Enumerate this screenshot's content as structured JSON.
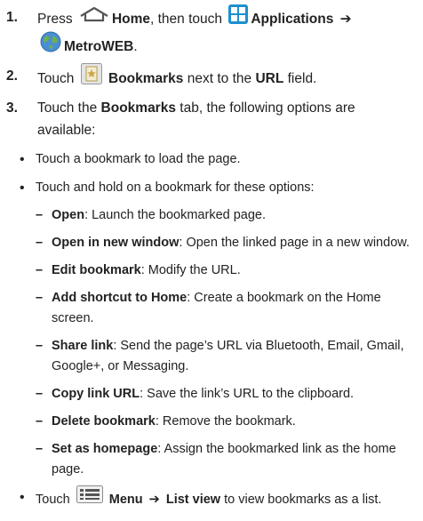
{
  "steps": [
    {
      "num": "1.",
      "press": "Press",
      "home": "Home",
      "then_touch": ", then touch",
      "applications": "Applications",
      "arrow": "➔",
      "metroweb": "MetroWEB",
      "end": "."
    },
    {
      "num": "2.",
      "touch": "Touch",
      "bookmarks": "Bookmarks",
      "next_to": "next to the",
      "url": "URL",
      "field": "field."
    },
    {
      "num": "3.",
      "touch_the": "Touch the",
      "bookmarks_tab": "Bookmarks",
      "rest": "tab, the following options are available:"
    }
  ],
  "bullets": {
    "b1": "Touch a bookmark to load the page.",
    "b2": "Touch and hold on a bookmark for these options:",
    "b3": {
      "touch": "Touch",
      "menu": "Menu",
      "arrow": "➔",
      "list_view": "List view",
      "rest": "to view bookmarks as a list."
    }
  },
  "options": [
    {
      "label": "Open",
      "desc": ": Launch the bookmarked page."
    },
    {
      "label": "Open in new window",
      "desc": ": Open the linked page in a new window."
    },
    {
      "label": "Edit bookmark",
      "desc": ": Modify the URL."
    },
    {
      "label": "Add shortcut to Home",
      "desc": ": Create a bookmark on the Home screen."
    },
    {
      "label": "Share link",
      "desc": ": Send the page’s URL via Bluetooth, Email, Gmail, Google+, or Messaging."
    },
    {
      "label": "Copy link URL",
      "desc": ": Save the link’s URL to the clipboard."
    },
    {
      "label": "Delete bookmark",
      "desc": ": Remove the bookmark."
    },
    {
      "label": "Set as homepage",
      "desc": ": Assign the bookmarked link as the home page."
    }
  ],
  "dash": "–",
  "icons": {
    "home": "home-icon",
    "applications": "applications-icon",
    "metroweb": "globe-icon",
    "bookmarks": "bookmarks-icon",
    "menu": "menu-icon"
  },
  "colors": {
    "text": "#222222",
    "apps_blue": "#1d8fd0",
    "bookmark_gold": "#c9a64a"
  }
}
